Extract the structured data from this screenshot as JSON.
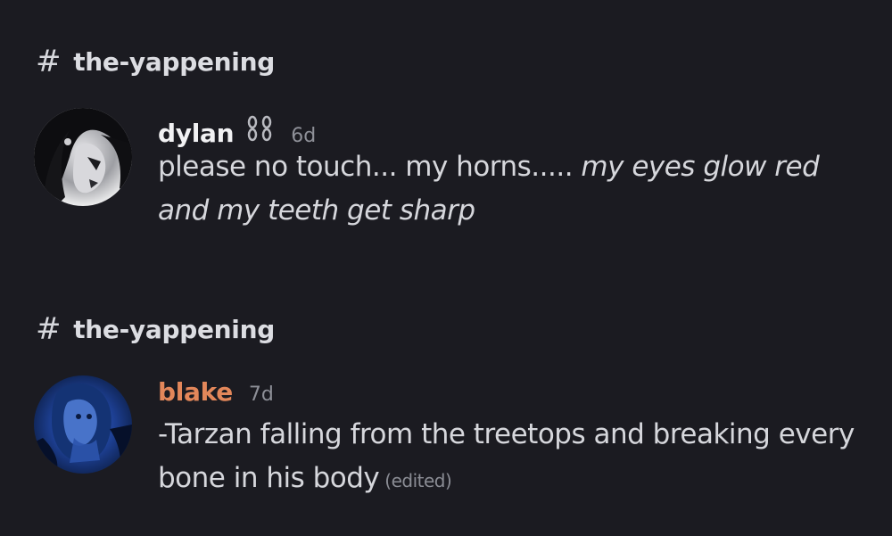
{
  "messages": [
    {
      "channel": "the-yappening",
      "author": "dylan",
      "author_color": "#f1f1f3",
      "badge_icon": "chain-icon",
      "time": "6d",
      "text_plain": "please no touch... my horns..... ",
      "text_italic": "my eyes glow red and my teeth get sharp",
      "edited": ""
    },
    {
      "channel": "the-yappening",
      "author": "blake",
      "author_color": "#e3875a",
      "time": "7d",
      "text_plain": "-Tarzan falling from the treetops and breaking every bone in his body",
      "text_italic": "",
      "edited": "(edited)"
    }
  ]
}
